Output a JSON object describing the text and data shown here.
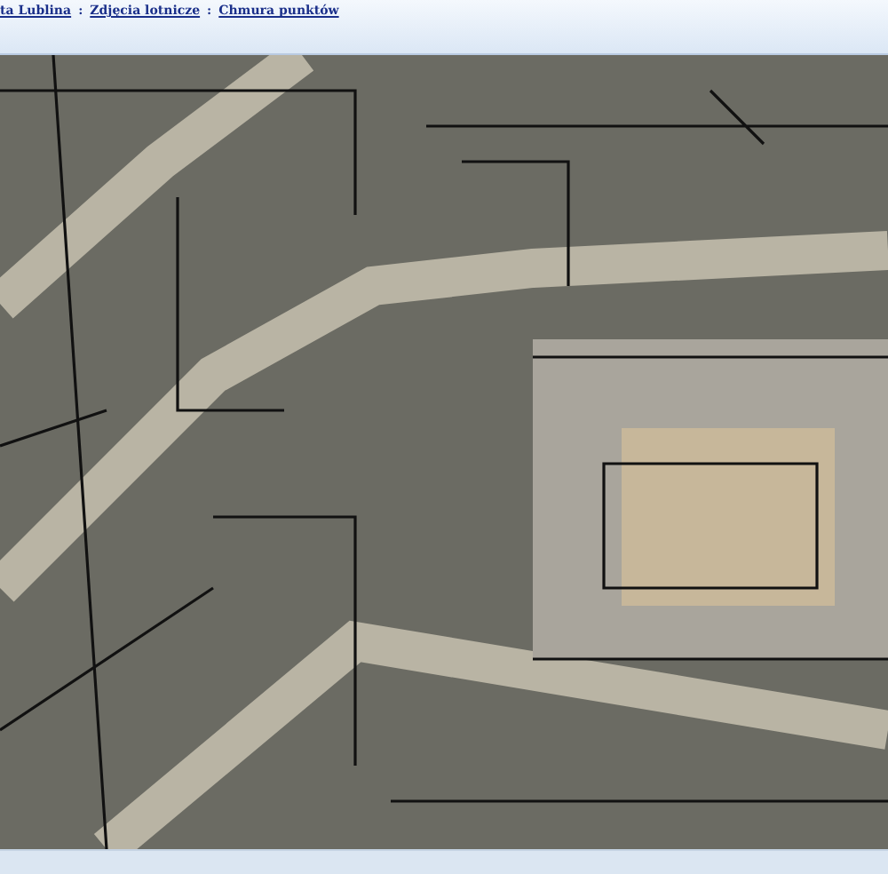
{
  "breadcrumb": {
    "separator": ":",
    "items": [
      {
        "label": "ta Lublina"
      },
      {
        "label": "Zdjęcia lotnicze"
      },
      {
        "label": "Chmura punktów"
      }
    ]
  },
  "map": {
    "kind": "aerial"
  }
}
